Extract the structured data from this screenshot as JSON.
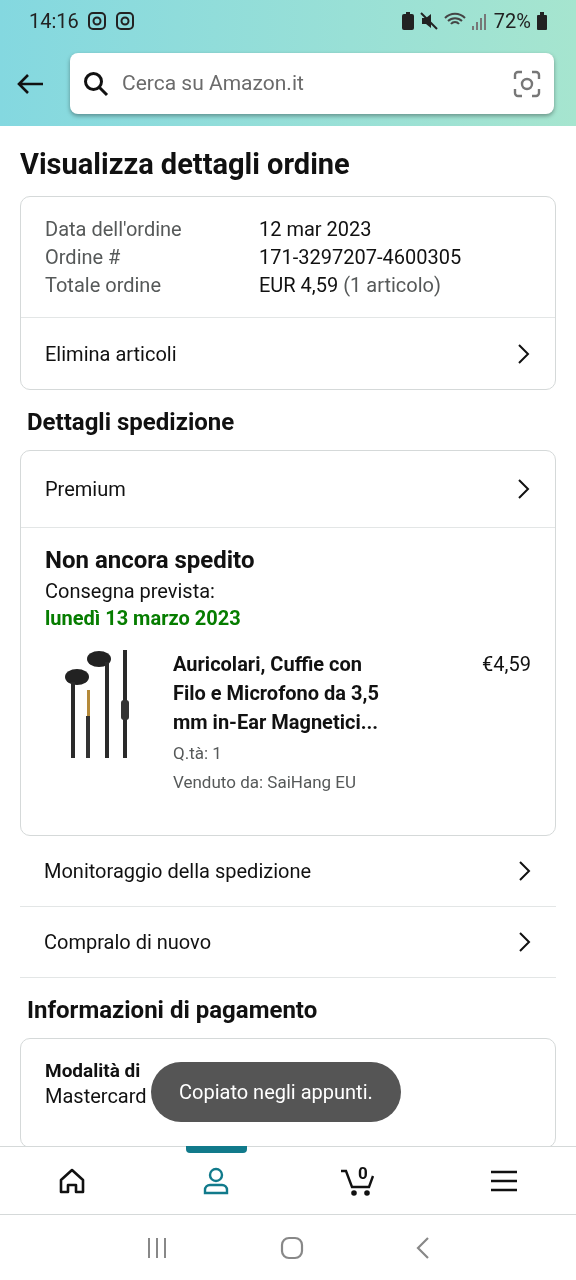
{
  "status_bar": {
    "time": "14:16",
    "battery": "72%"
  },
  "search": {
    "placeholder": "Cerca su Amazon.it"
  },
  "title": "Visualizza dettagli ordine",
  "order_summary": [
    {
      "label": "Data dell'ordine",
      "value": "12 mar 2023"
    },
    {
      "label": "Ordine #",
      "value": "171-3297207-4600305"
    },
    {
      "label": "Totale ordine",
      "value": "EUR 4,59",
      "extra": "(1 articolo)"
    }
  ],
  "order_action": "Elimina articoli",
  "shipping": {
    "heading": "Dettagli spedizione",
    "method": "Premium",
    "status": "Non ancora spedito",
    "delivery_label": "Consegna prevista:",
    "delivery_date": "lunedì 13 marzo 2023",
    "item": {
      "name": "Auricolari, Cuffie con Filo e Microfono da 3,5 mm in-Ear Magnetici...",
      "price": "€4,59",
      "quantity": "Q.tà: 1",
      "seller": "Venduto da: SaiHang EU"
    }
  },
  "links": [
    "Monitoraggio della spedizione",
    "Compralo di nuovo"
  ],
  "payment": {
    "heading": "Informazioni di pagamento",
    "method_label": "Modalità di",
    "method_value": "Mastercard"
  },
  "toast": "Copiato negli appunti.",
  "bottom_nav": [
    {
      "kind": "home",
      "selected": false
    },
    {
      "kind": "account",
      "selected": true
    },
    {
      "kind": "cart",
      "selected": false,
      "count": "0"
    },
    {
      "kind": "menu",
      "selected": false
    }
  ]
}
